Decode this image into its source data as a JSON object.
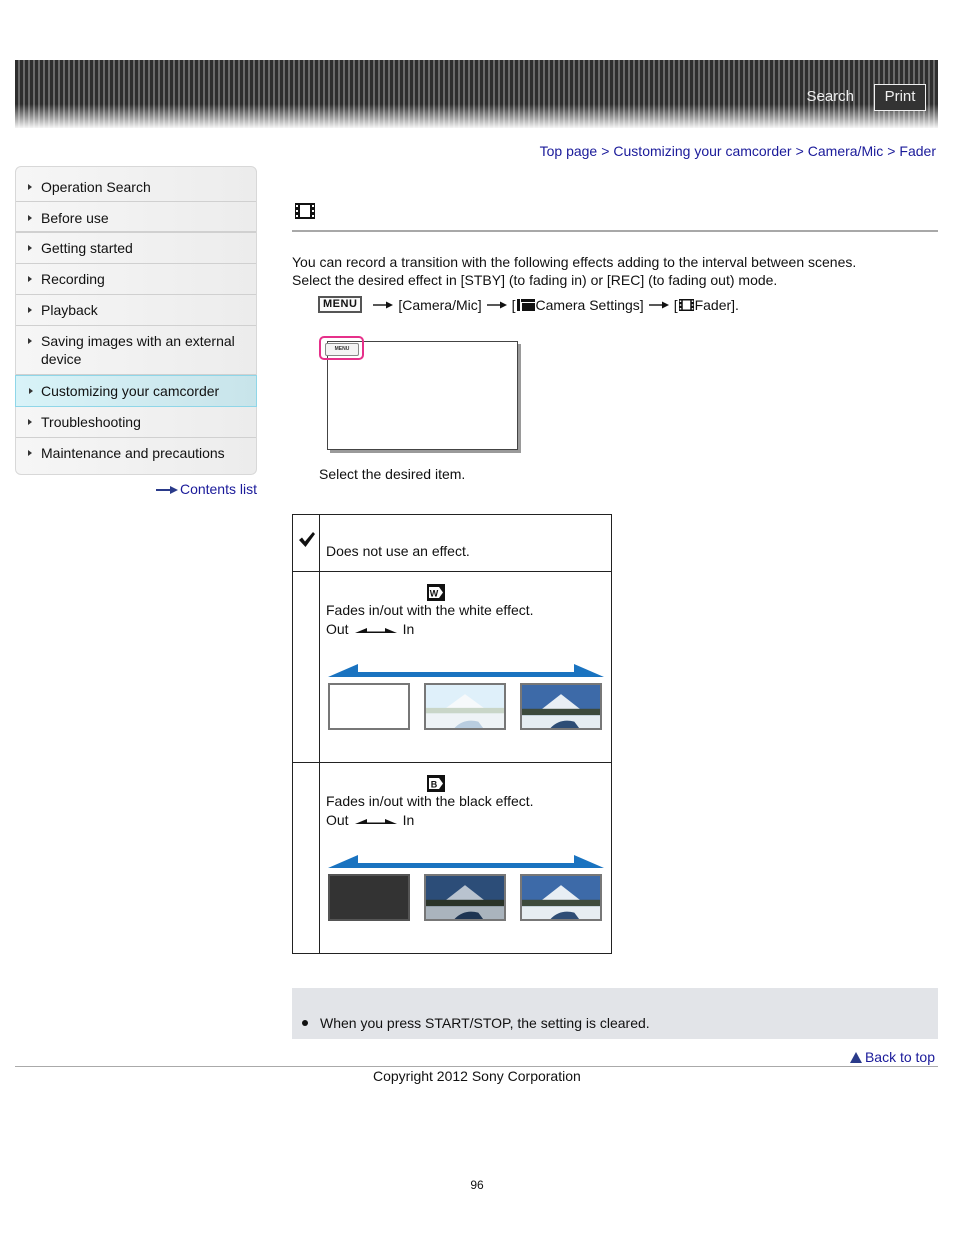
{
  "header": {
    "search_label": "Search",
    "print_label": "Print"
  },
  "breadcrumb": {
    "items": [
      "Top page",
      "Customizing your camcorder",
      "Camera/Mic",
      "Fader"
    ],
    "separator": ">"
  },
  "sidebar": {
    "items": [
      {
        "label": "Operation Search",
        "active": false
      },
      {
        "label": "Before use",
        "active": false
      },
      {
        "label": "Getting started",
        "active": false
      },
      {
        "label": "Recording",
        "active": false
      },
      {
        "label": "Playback",
        "active": false
      },
      {
        "label": "Saving images with an external device",
        "active": false
      },
      {
        "label": "Customizing your camcorder",
        "active": true
      },
      {
        "label": "Troubleshooting",
        "active": false
      },
      {
        "label": "Maintenance and precautions",
        "active": false
      }
    ],
    "contents_link": "Contents list"
  },
  "page": {
    "title_icon": "fader-film-icon",
    "intro_line1": "You can record a transition with the following effects adding to the interval between scenes.",
    "intro_line2": "Select the desired effect in [STBY] (to fading in) or [REC] (to fading out) mode.",
    "menu_path": {
      "menu_key": "MENU",
      "step1": "[Camera/Mic]",
      "step2_prefix": "[",
      "step2": "Camera Settings]",
      "step3_prefix": "[",
      "step3": "Fader]."
    },
    "screen_menu_label": "MENU",
    "select_text": "Select the desired item.",
    "options": [
      {
        "icon": "checkmark-icon",
        "description": "Does not use an effect."
      },
      {
        "icon": "white-fader-icon",
        "icon_letter": "W",
        "description": "Fades in/out with the white effect.",
        "out_label": "Out",
        "in_label": "In",
        "thumbnails": [
          "white-frame",
          "faded-landscape",
          "landscape"
        ]
      },
      {
        "icon": "black-fader-icon",
        "icon_letter": "B",
        "description": "Fades in/out with the black effect.",
        "out_label": "Out",
        "in_label": "In",
        "thumbnails": [
          "black-frame",
          "darkened-landscape",
          "landscape"
        ]
      }
    ],
    "note": "When you press START/STOP, the setting is cleared."
  },
  "footer": {
    "back_to_top": "Back to top",
    "copyright": "Copyright 2012 Sony Corporation",
    "page_number": "96"
  },
  "colors": {
    "link": "#1a1a9a",
    "highlight_pink": "#e6308a",
    "arrow_blue": "#1a73c0",
    "note_bg": "#e2e4e8"
  }
}
